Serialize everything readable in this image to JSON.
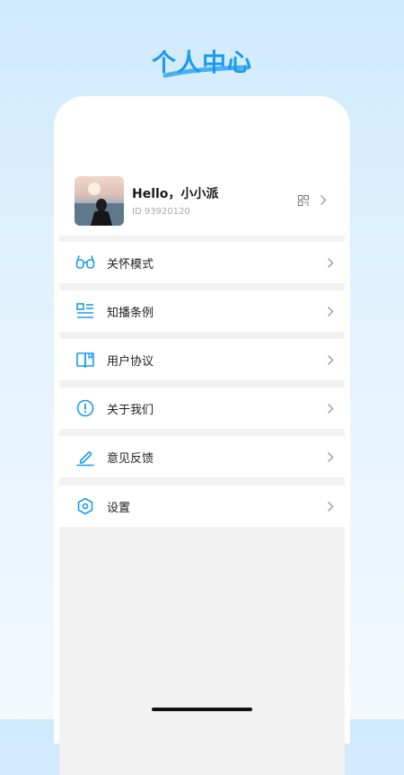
{
  "header": {
    "title": "个人中心",
    "accent_color": "#1a9bef"
  },
  "profile": {
    "greeting": "Hello，小小派",
    "user_id": "ID 93920120",
    "avatar_icon": "user-avatar-photo",
    "qr_icon": "qr-code-icon",
    "chevron_icon": "chevron-right-icon"
  },
  "menu": {
    "items": [
      {
        "label": "关怀模式",
        "icon": "glasses-icon"
      },
      {
        "label": "知播条例",
        "icon": "list-document-icon"
      },
      {
        "label": "用户协议",
        "icon": "book-icon"
      },
      {
        "label": "关于我们",
        "icon": "info-circle-icon"
      },
      {
        "label": "意见反馈",
        "icon": "pen-icon"
      },
      {
        "label": "设置",
        "icon": "hexagon-settings-icon"
      }
    ]
  },
  "colors": {
    "icon_color": "#1a9bef",
    "chevron_color": "#9a9a9a",
    "divider_color": "#f2f2f2"
  }
}
